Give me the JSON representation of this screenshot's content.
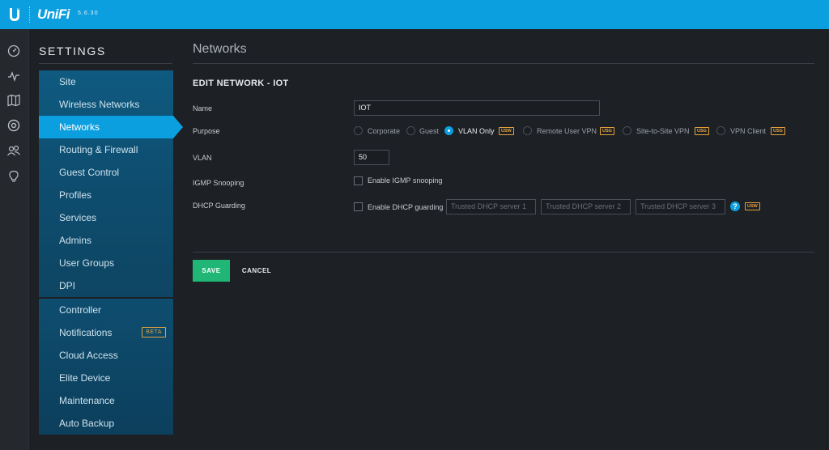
{
  "header": {
    "brand": "UniFi",
    "version": "5.6.30",
    "logo_icon": "ubiquiti-u-logo",
    "accent_color": "#0c9fe0"
  },
  "rail": {
    "icons": [
      "dashboard-icon",
      "statistics-icon",
      "map-icon",
      "devices-icon",
      "clients-icon",
      "insights-icon"
    ]
  },
  "settings": {
    "title": "SETTINGS",
    "group1": [
      {
        "label": "Site"
      },
      {
        "label": "Wireless Networks"
      },
      {
        "label": "Networks",
        "active": true
      },
      {
        "label": "Routing & Firewall"
      },
      {
        "label": "Guest Control"
      },
      {
        "label": "Profiles"
      },
      {
        "label": "Services"
      },
      {
        "label": "Admins"
      },
      {
        "label": "User Groups"
      },
      {
        "label": "DPI"
      }
    ],
    "group2": [
      {
        "label": "Controller"
      },
      {
        "label": "Notifications",
        "badge": "BETA"
      },
      {
        "label": "Cloud Access"
      },
      {
        "label": "Elite Device"
      },
      {
        "label": "Maintenance"
      },
      {
        "label": "Auto Backup"
      }
    ]
  },
  "main": {
    "page_title": "Networks",
    "section_title": "EDIT NETWORK - IOT",
    "name_label": "Name",
    "name_value": "IOT",
    "purpose_label": "Purpose",
    "purpose_options": [
      {
        "label": "Corporate"
      },
      {
        "label": "Guest"
      },
      {
        "label": "VLAN Only",
        "tag": "USW",
        "selected": true
      },
      {
        "label": "Remote User VPN",
        "tag": "USG"
      },
      {
        "label": "Site-to-Site VPN",
        "tag": "USG"
      },
      {
        "label": "VPN Client",
        "tag": "USG"
      }
    ],
    "vlan_label": "VLAN",
    "vlan_value": "50",
    "igmp_label": "IGMP Snooping",
    "igmp_checkbox_label": "Enable IGMP snooping",
    "dhcp_label": "DHCP Guarding",
    "dhcp_checkbox_label": "Enable DHCP guarding",
    "dhcp_placeholders": [
      "Trusted DHCP server 1",
      "Trusted DHCP server 2",
      "Trusted DHCP server 3"
    ],
    "help_glyph": "?",
    "dhcp_tag": "USW",
    "save_label": "SAVE",
    "cancel_label": "CANCEL",
    "save_color": "#1fb676"
  }
}
